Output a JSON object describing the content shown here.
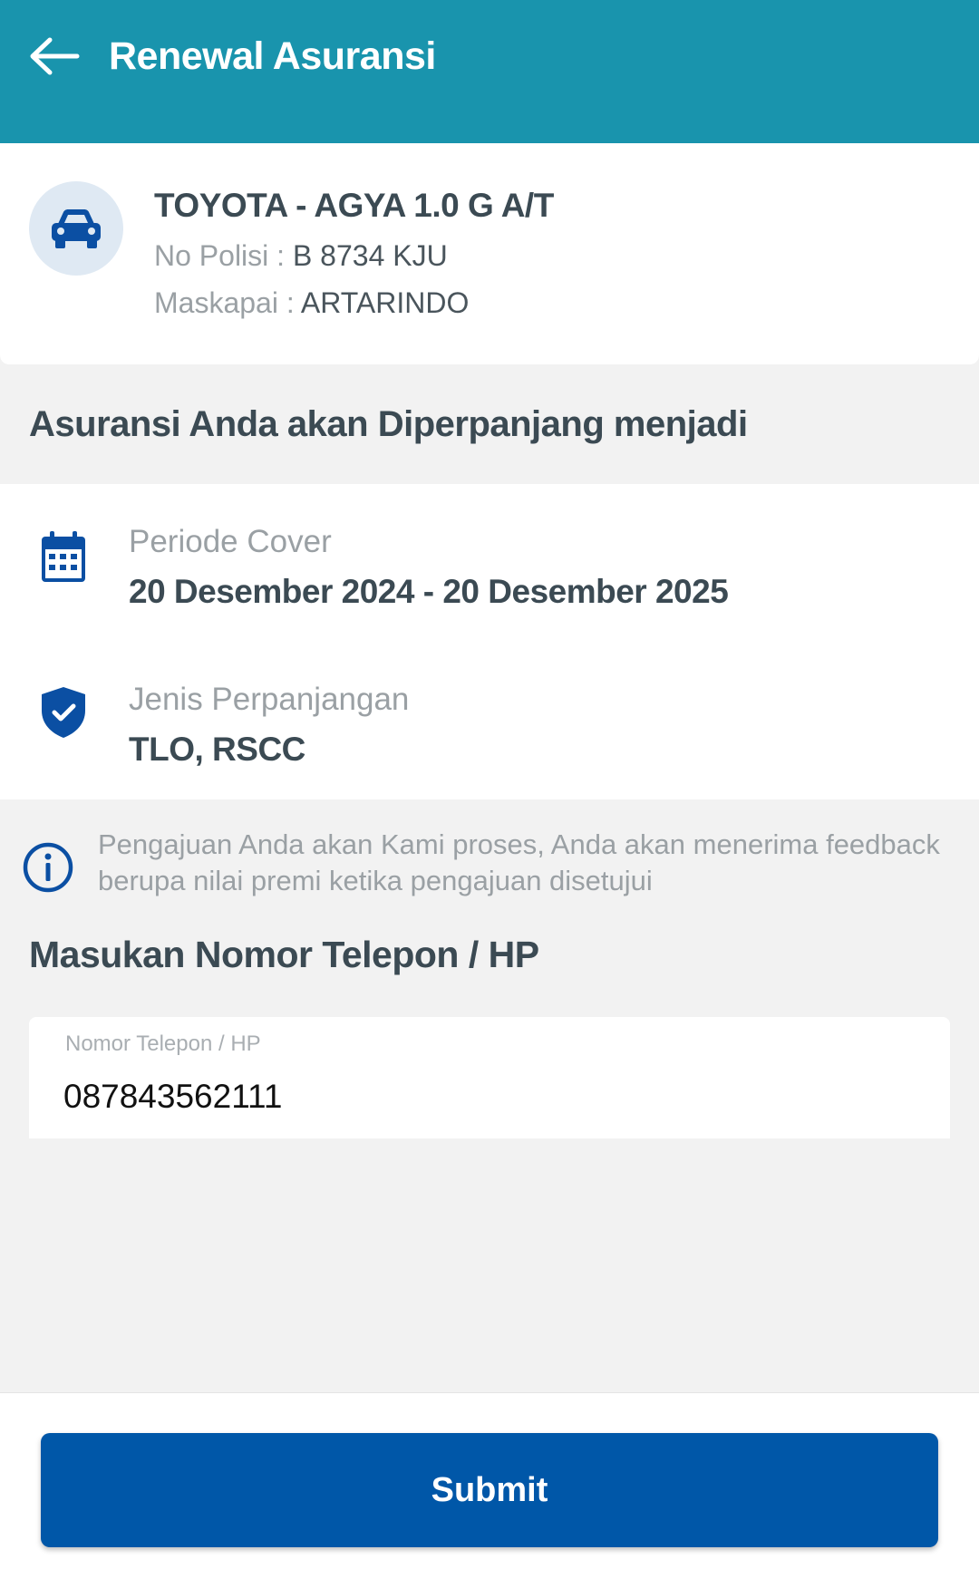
{
  "appbar": {
    "title": "Renewal Asuransi",
    "back_icon": "arrow-left-icon"
  },
  "vehicle": {
    "icon": "car-icon",
    "name": "TOYOTA - AGYA 1.0 G A/T",
    "polisi_label": "No Polisi : ",
    "polisi_value": "B 8734 KJU",
    "maskapai_label": "Maskapai : ",
    "maskapai_value": "ARTARINDO"
  },
  "renewal": {
    "heading": "Asuransi Anda akan Diperpanjang menjadi",
    "periode_label": "Periode Cover",
    "periode_value": "20 Desember 2024 - 20 Desember 2025",
    "jenis_label": "Jenis Perpanjangan",
    "jenis_value": "TLO, RSCC"
  },
  "info": {
    "icon": "info-icon",
    "text": "Pengajuan Anda akan Kami proses, Anda akan menerima feedback berupa nilai premi ketika pengajuan disetujui"
  },
  "phone": {
    "heading": "Masukan Nomor Telepon / HP",
    "field_label": "Nomor Telepon / HP",
    "value": "087843562111"
  },
  "footer": {
    "submit_label": "Submit"
  },
  "colors": {
    "appbar": "#1994ad",
    "primary_button": "#0057a8",
    "icon_blue": "#0b4fa3"
  }
}
